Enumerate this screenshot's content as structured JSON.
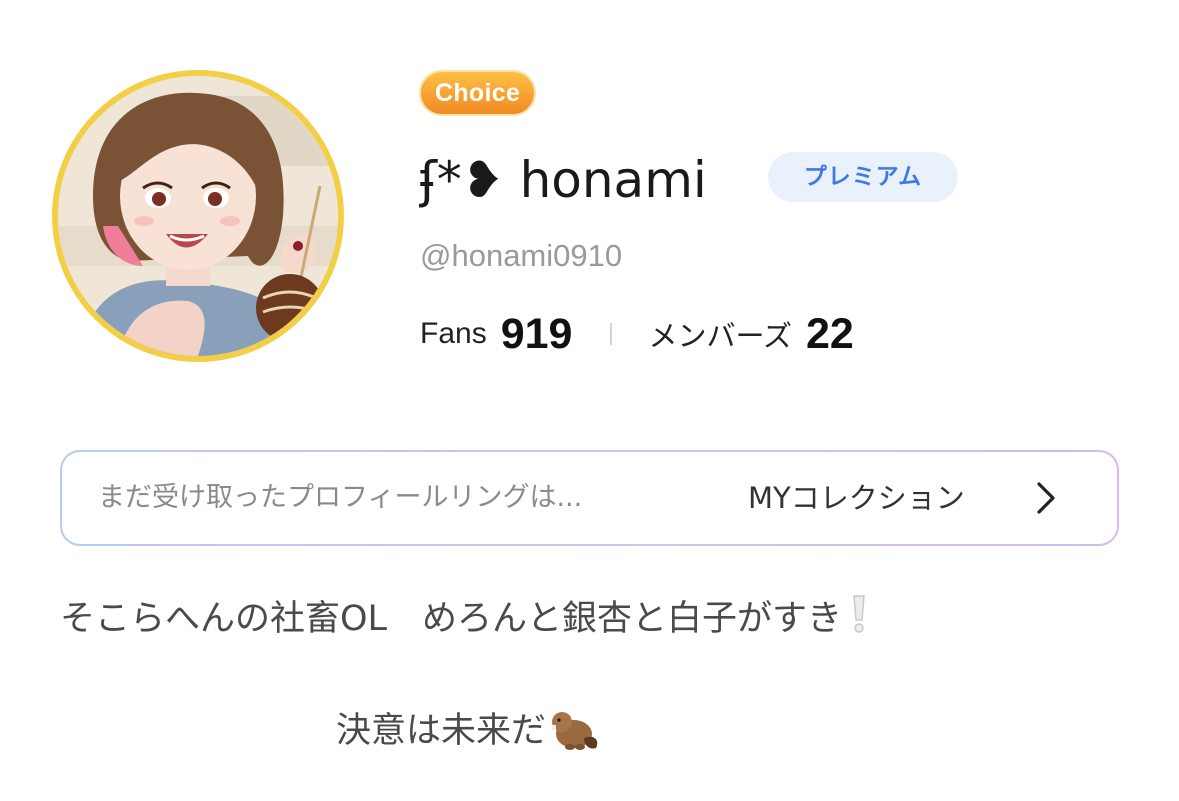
{
  "profile": {
    "choice_badge": "Choice",
    "display_name": "ʄ*❥ honami",
    "premium_badge": "プレミアム",
    "handle": "@honami0910",
    "avatar_icon": "profile-avatar-illustration"
  },
  "stats": {
    "fans_label": "Fans",
    "fans_value": "919",
    "members_label": "メンバーズ",
    "members_value": "22"
  },
  "collection": {
    "hint": "まだ受け取ったプロフィールリングは...",
    "link_label": "MYコレクション",
    "chevron_icon": "chevron-right-icon"
  },
  "bio": {
    "line1": "そこらへんの社畜OL　めろんと銀杏と白子がすき",
    "line2": "決意は未来だ",
    "exclaim_icon": "white-exclamation-icon",
    "beaver_icon": "beaver-emoji-icon"
  },
  "colors": {
    "choice_badge": "#f39a2d",
    "premium_bg": "#e9f1fd",
    "premium_text": "#3f7ae4",
    "avatar_ring": "#f3cf47"
  }
}
